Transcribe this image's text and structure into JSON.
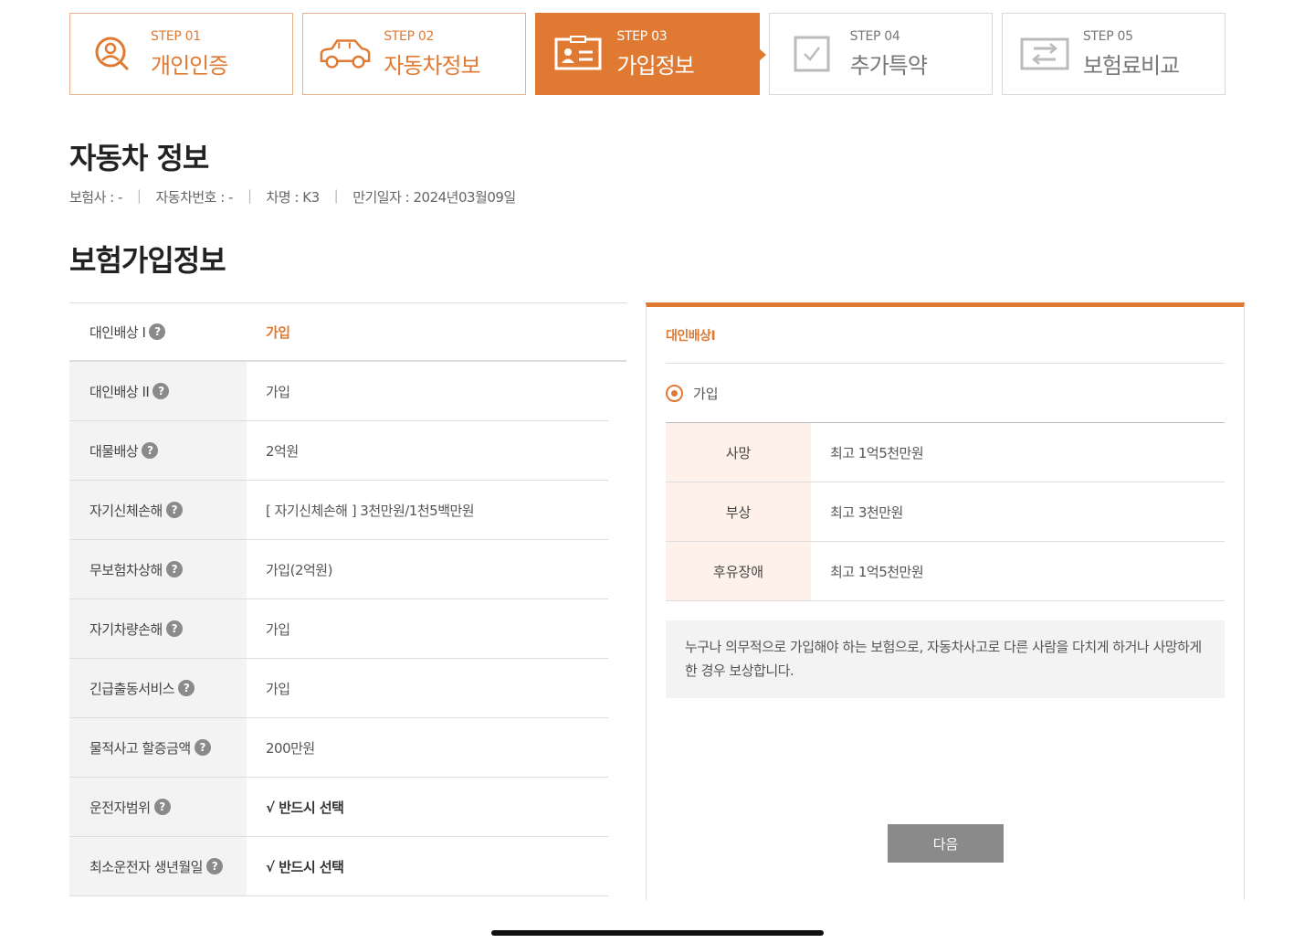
{
  "steps": [
    {
      "num": "STEP 01",
      "label": "개인인증",
      "icon": "person-search-icon",
      "state": "done"
    },
    {
      "num": "STEP 02",
      "label": "자동차정보",
      "icon": "car-icon",
      "state": "done"
    },
    {
      "num": "STEP 03",
      "label": "가입정보",
      "icon": "id-card-icon",
      "state": "active"
    },
    {
      "num": "STEP 04",
      "label": "추가특약",
      "icon": "checkbox-icon",
      "state": "todo"
    },
    {
      "num": "STEP 05",
      "label": "보험료비교",
      "icon": "compare-icon",
      "state": "todo"
    }
  ],
  "car": {
    "title": "자동차 정보",
    "insurer": "보험사 : -",
    "plate": "자동차번호 : -",
    "model": "차명 : K3",
    "expiry": "만기일자 : 2024년03월09일"
  },
  "join": {
    "title": "보험가입정보",
    "rows": [
      {
        "label": "대인배상 I",
        "value": "가입"
      },
      {
        "label": "대인배상 II",
        "value": "가입"
      },
      {
        "label": "대물배상",
        "value": "2억원"
      },
      {
        "label": "자기신체손해",
        "value": "[ 자기신체손해 ]  3천만원/1천5백만원"
      },
      {
        "label": "무보험차상해",
        "value": "가입(2억원)"
      },
      {
        "label": "자기차량손해",
        "value": "가입"
      },
      {
        "label": "긴급출동서비스",
        "value": "가입"
      },
      {
        "label": "물적사고 할증금액",
        "value": "200만원"
      },
      {
        "label": "운전자범위",
        "value": "√ 반드시 선택"
      },
      {
        "label": "최소운전자 생년월일",
        "value": "√ 반드시 선택"
      }
    ],
    "help_glyph": "?"
  },
  "panel": {
    "title": "대인배상I",
    "option": "가입",
    "coverage": [
      {
        "k": "사망",
        "v": "최고 1억5천만원"
      },
      {
        "k": "부상",
        "v": "최고 3천만원"
      },
      {
        "k": "후유장애",
        "v": "최고 1억5천만원"
      }
    ],
    "description": "누구나 의무적으로 가입해야 하는 보험으로, 자동차사고로 다른 사람을 다치게 하거나 사망하게 한 경우 보상합니다.",
    "next_label": "다음"
  },
  "colors": {
    "accent": "#e07a33",
    "button": "#8a8a8a"
  }
}
